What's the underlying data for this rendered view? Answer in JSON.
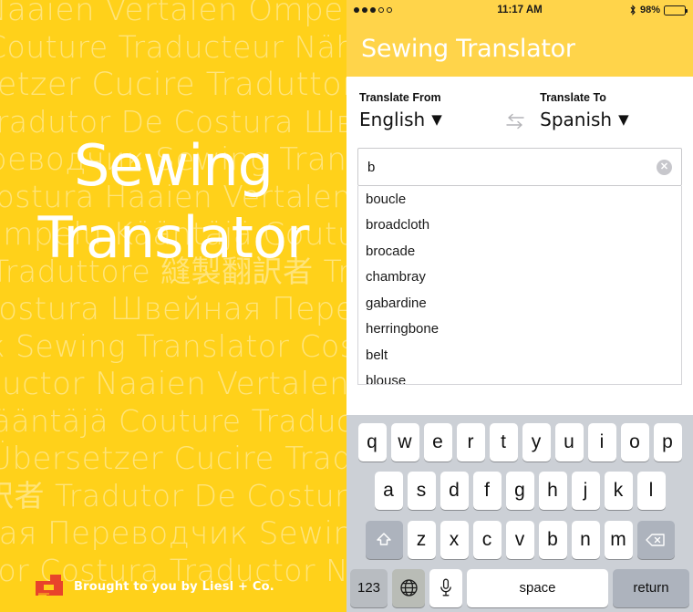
{
  "splash": {
    "title_line1": "Sewing",
    "title_line2": "Translator",
    "footer_text": "Brought to you by Liesl + Co.",
    "logo_icon": "sewing-machine-icon",
    "bg_color": "#FFD11A",
    "bg_word_lines": [
      "Naaien Vertalen Ompelu Kääntäjä",
      "Couture Traducteur Nähen Übersetzer",
      "setzer Cucire Traduttore 縫製翻訳者",
      "Tradutor De Costura Швейная",
      "реводчик Sewing Translator",
      "Costura Наaien Vertalen",
      "Ompelu Kääntäjä Couture Traducteur",
      "Traduttore 縫製翻訳者 Tradutor",
      "Costura Швейная Переводчик",
      "к Sewing Translator Costura",
      "ductor Naaien Vertalen Ompelu",
      "Kääntäjä Couture Traducteur",
      "Übersetzer Cucire Traduttore",
      "訳者 Tradutor De Costura Шв",
      "ная Переводчик Sewing",
      "tor Costura Traductor Naaien"
    ]
  },
  "statusbar": {
    "signal_dots_filled": 3,
    "signal_dots_total": 5,
    "time": "11:17 AM",
    "bluetooth_icon": "bluetooth-icon",
    "battery_percent": "98%",
    "battery_level": 98
  },
  "navbar": {
    "title": "Sewing Translator",
    "bg_color": "#FFD44A"
  },
  "translate": {
    "from_label": "Translate From",
    "from_value": "English",
    "to_label": "Translate To",
    "to_value": "Spanish",
    "caret": "▼",
    "swap_icon": "swap-arrows-icon"
  },
  "search": {
    "value": "b",
    "placeholder": "",
    "clear_icon": "clear-circle-icon",
    "clear_glyph": "✕"
  },
  "suggestions": [
    "boucle",
    "broadcloth",
    "brocade",
    "chambray",
    "gabardine",
    "herringbone",
    "belt",
    "blouse"
  ],
  "keyboard": {
    "row1": [
      "q",
      "w",
      "e",
      "r",
      "t",
      "y",
      "u",
      "i",
      "o",
      "p"
    ],
    "row2": [
      "a",
      "s",
      "d",
      "f",
      "g",
      "h",
      "j",
      "k",
      "l"
    ],
    "row3_letters": [
      "z",
      "x",
      "c",
      "v",
      "b",
      "n",
      "m"
    ],
    "shift_icon": "shift-arrow-icon",
    "delete_icon": "backspace-icon",
    "numbers_label": "123",
    "globe_icon": "globe-icon",
    "mic_icon": "microphone-icon",
    "space_label": "space",
    "return_label": "return"
  }
}
